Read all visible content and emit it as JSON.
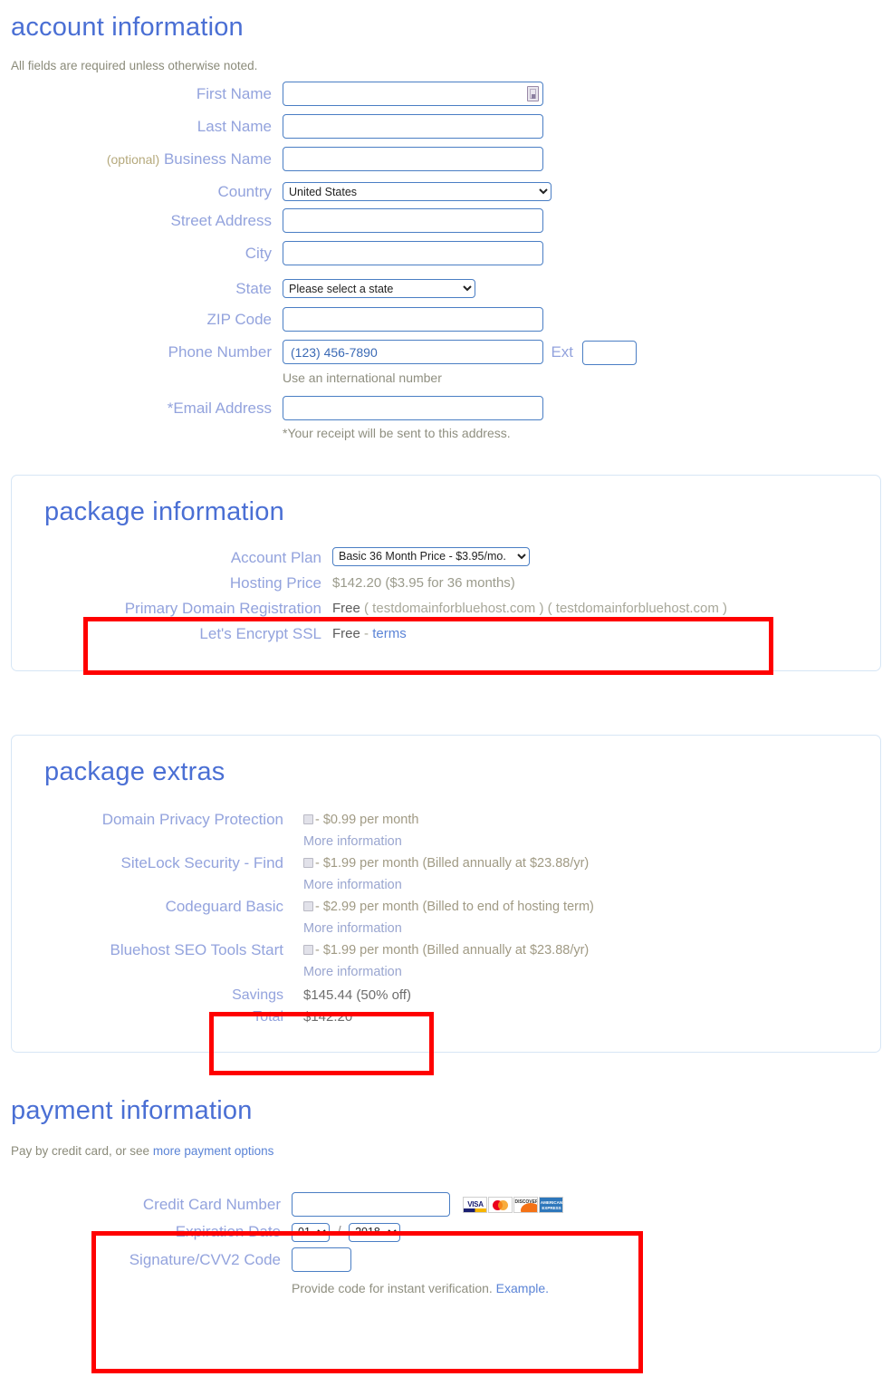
{
  "account": {
    "title": "account information",
    "note": "All fields are required unless otherwise noted.",
    "fields": {
      "first_name": {
        "label": "First Name",
        "value": "",
        "icon": "autofill-contact-icon"
      },
      "last_name": {
        "label": "Last Name",
        "value": ""
      },
      "business_name": {
        "label": "Business Name",
        "optional_tag": "(optional)",
        "value": ""
      },
      "country": {
        "label": "Country",
        "value": "United States"
      },
      "street_address": {
        "label": "Street Address",
        "value": ""
      },
      "city": {
        "label": "City",
        "value": ""
      },
      "state": {
        "label": "State",
        "value": "Please select a state"
      },
      "zip": {
        "label": "ZIP Code",
        "value": ""
      },
      "phone": {
        "label": "Phone Number",
        "value": "(123) 456-7890",
        "ext_label": "Ext",
        "ext_value": "",
        "helper": "Use an international number"
      },
      "email": {
        "label": "*Email Address",
        "value": "",
        "helper": "*Your receipt will be sent to this address."
      }
    }
  },
  "package_information": {
    "title": "package information",
    "rows": [
      {
        "label": "Account Plan",
        "type": "select",
        "value": "Basic 36 Month Price - $3.95/mo."
      },
      {
        "label": "Hosting Price",
        "type": "text",
        "value": "$142.20  ($3.95 for 36 months)"
      },
      {
        "label": "Primary Domain Registration",
        "type": "domain",
        "free": "Free",
        "domain1": "( testdomainforbluehost.com )",
        "domain2": "( testdomainforbluehost.com )"
      },
      {
        "label": "Let's Encrypt SSL",
        "type": "ssl",
        "free": "Free",
        "dash": "-",
        "link": "terms"
      }
    ]
  },
  "package_extras": {
    "title": "package extras",
    "items": [
      {
        "label": "Domain Privacy Protection",
        "price_text": "- $0.99 per month",
        "checked": false,
        "more": "More information"
      },
      {
        "label": "SiteLock Security - Find",
        "price_text": "- $1.99 per month (Billed annually at $23.88/yr)",
        "checked": false,
        "more": "More information"
      },
      {
        "label": "Codeguard Basic",
        "price_text": "- $2.99 per month (Billed to end of hosting term)",
        "checked": false,
        "more": "More information"
      },
      {
        "label": "Bluehost SEO Tools Start",
        "price_text": "- $1.99 per month (Billed annually at $23.88/yr)",
        "checked": false,
        "more": "More information"
      }
    ],
    "savings_label": "Savings",
    "savings_value": "$145.44 (50% off)",
    "total_label": "Total",
    "total_value": "$142.20"
  },
  "payment_information": {
    "title": "payment information",
    "note_prefix": "Pay by credit card, or see ",
    "note_link": "more payment options",
    "card_number_label": "Credit Card Number",
    "card_number_value": "",
    "card_logos": [
      "visa-logo",
      "mastercard-logo",
      "discover-logo",
      "amex-logo"
    ],
    "expiration_label": "Expiration Date",
    "expiration_month": "01",
    "expiration_separator": "/",
    "expiration_year": "2018",
    "cvv_label": "Signature/CVV2 Code",
    "cvv_value": "",
    "cvv_helper_prefix": "Provide code for instant verification. ",
    "cvv_helper_link": "Example."
  },
  "annotations": {
    "highlight_color": "#ff0000",
    "boxes": [
      "package-domain-ssl-highlight",
      "savings-total-highlight",
      "credit-card-fields-highlight"
    ]
  },
  "colors": {
    "heading_blue": "#4a6fd4",
    "label_blue": "#93a3dd",
    "input_border": "#4a7ec4",
    "panel_border": "#d7e6f5",
    "link_blue": "#5b84d6",
    "muted_text": "#9b9b8c"
  }
}
